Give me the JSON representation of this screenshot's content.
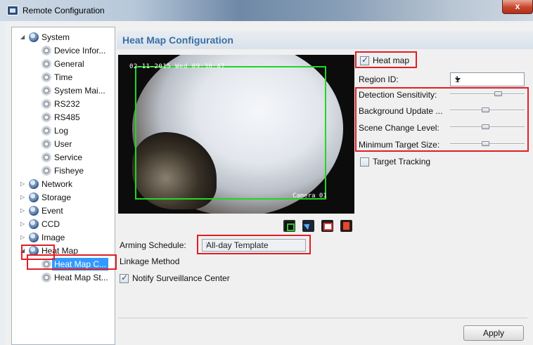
{
  "window": {
    "title": "Remote Configuration",
    "close_label": "x"
  },
  "tree": {
    "system": {
      "label": "System",
      "children": [
        "Device Infor...",
        "General",
        "Time",
        "System Mai...",
        "RS232",
        "RS485",
        "Log",
        "User",
        "Service",
        "Fisheye"
      ]
    },
    "groups": [
      "Network",
      "Storage",
      "Event",
      "CCD",
      "Image"
    ],
    "heatmap": {
      "label": "Heat Map",
      "children": [
        "Heat Map C...",
        "Heat Map St..."
      ],
      "selected": "Heat Map C..."
    }
  },
  "panel": {
    "title": "Heat Map Configuration",
    "video": {
      "timestamp": "02-11-2015 Wed 09:38:47",
      "camera_label": "Camera 01"
    },
    "heatmap_checkbox": {
      "label": "Heat map",
      "checked": true
    },
    "region_id": {
      "label": "Region ID:",
      "value": "1"
    },
    "sliders": [
      {
        "label": "Detection Sensitivity:",
        "level_pct": 68
      },
      {
        "label": "Background Update ...",
        "level_pct": 48
      },
      {
        "label": "Scene Change Level:",
        "level_pct": 48
      },
      {
        "label": "Minimum Target Size:",
        "level_pct": 48
      }
    ],
    "target_tracking": {
      "label": "Target Tracking",
      "checked": false
    },
    "arming_schedule": {
      "label": "Arming Schedule:",
      "value": "All-day Template"
    },
    "linkage_method": {
      "label": "Linkage Method"
    },
    "notify_center": {
      "label": "Notify Surveillance Center",
      "checked": true
    },
    "apply_label": "Apply"
  },
  "colors": {
    "highlight_red": "#e01f26",
    "region_green": "#22d622",
    "title_blue": "#3a6fa4",
    "selection_blue": "#3399ff"
  },
  "icons": {
    "tree_top": "gear-globe-icon",
    "tree_leaf": "gear-icon",
    "toolbar": [
      "draw-area-icon",
      "select-icon",
      "clear-icon",
      "delete-icon"
    ]
  }
}
